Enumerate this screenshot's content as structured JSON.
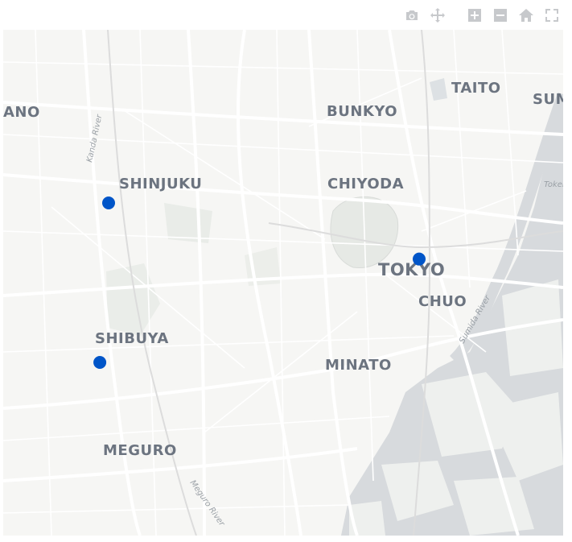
{
  "modebar": {
    "buttons": [
      {
        "name": "camera-icon",
        "title": "Download plot as a png"
      },
      {
        "name": "pan-icon",
        "title": "Pan"
      },
      {
        "name": "zoom-in-icon",
        "title": "Zoom in"
      },
      {
        "name": "zoom-out-icon",
        "title": "Zoom out"
      },
      {
        "name": "home-icon",
        "title": "Reset view"
      },
      {
        "name": "fullscreen-icon",
        "title": "Fullscreen"
      }
    ],
    "icon_color": "#c7c9cc"
  },
  "map": {
    "districts": [
      {
        "key": "nakano",
        "label": "ANO"
      },
      {
        "key": "bunkyo",
        "label": "BUNKYO"
      },
      {
        "key": "taito",
        "label": "TAITO"
      },
      {
        "key": "sumida",
        "label": "SUM"
      },
      {
        "key": "shinjuku",
        "label": "SHINJUKU"
      },
      {
        "key": "chiyoda",
        "label": "CHIYODA"
      },
      {
        "key": "tokyo",
        "label": "TOKYO"
      },
      {
        "key": "chuo",
        "label": "CHUO"
      },
      {
        "key": "shibuya",
        "label": "SHIBUYA"
      },
      {
        "key": "minato",
        "label": "MINATO"
      },
      {
        "key": "meguro",
        "label": "MEGURO"
      }
    ],
    "rivers": [
      {
        "key": "kanda",
        "label": "Kanda River"
      },
      {
        "key": "sumida",
        "label": "Sumida River"
      },
      {
        "key": "meguro",
        "label": "Meguro River"
      },
      {
        "key": "tokyo_bay",
        "label": "Tokel"
      }
    ],
    "markers": [
      {
        "name": "Shinjuku",
        "lat": 35.6938,
        "lon": 139.7034
      },
      {
        "name": "Tokyo",
        "lat": 35.6812,
        "lon": 139.7671
      },
      {
        "name": "Shibuya",
        "lat": 35.658,
        "lon": 139.7016
      }
    ],
    "marker_color": "#0055c8"
  }
}
